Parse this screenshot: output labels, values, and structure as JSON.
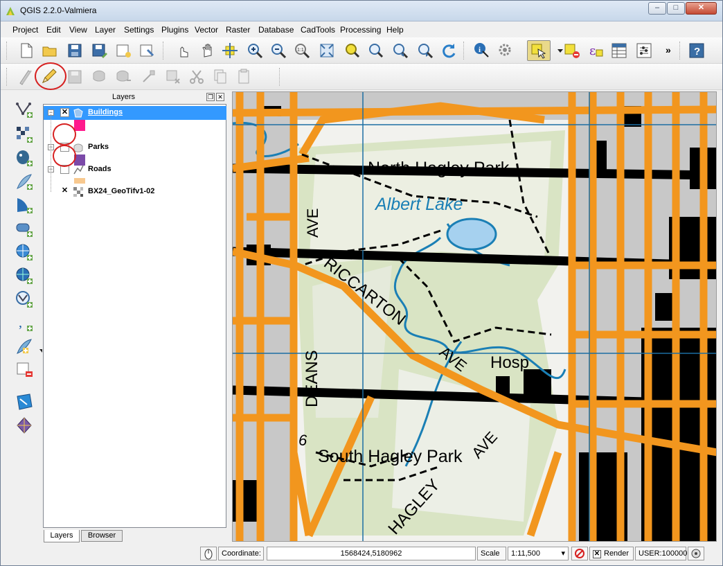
{
  "window": {
    "title": "QGIS 2.2.0-Valmiera",
    "min": "–",
    "max": "□",
    "close": "✕"
  },
  "menubar": [
    "Project",
    "Edit",
    "View",
    "Layer",
    "Settings",
    "Plugins",
    "Vector",
    "Raster",
    "Database",
    "CadTools",
    "Processing",
    "Help"
  ],
  "toolbar_overflow": "»",
  "layers_panel": {
    "title": "Layers",
    "float_label": "❐",
    "close_label": "✕",
    "layers": [
      {
        "name": "Buildings",
        "checked": true,
        "expanded": true,
        "selected": true,
        "swatch": "#ff1a8c"
      },
      {
        "name": "Parks",
        "checked": false,
        "expanded": true,
        "selected": false,
        "swatch": "#7b4aa8"
      },
      {
        "name": "Roads",
        "checked": false,
        "expanded": true,
        "selected": false,
        "swatch": "#f8c98f"
      },
      {
        "name": "BX24_GeoTifv1-02",
        "checked": true,
        "expanded": false,
        "selected": false,
        "swatch": ""
      }
    ],
    "tabs": [
      "Layers",
      "Browser"
    ]
  },
  "map": {
    "labels": {
      "north_hagley": "North Hagley Park",
      "albert_lake": "Albert Lake",
      "ave": "AVE",
      "riccarton": "RICCARTON",
      "ave2": "AVE",
      "hosp": "Hosp",
      "deans": "DEANS",
      "six": "6",
      "south_hagley": "South Hagley Park",
      "hagley": "HAGLEY",
      "ave3": "AVE"
    },
    "colors": {
      "road": "#f2961e",
      "park": "#d9e4c4",
      "water": "#1a7fb5",
      "building": "#000000",
      "block": "#c8c8c8",
      "grid": "#1c6ea3"
    }
  },
  "statusbar": {
    "coordinate_label": "Coordinate:",
    "coordinate_value": "1568424,5180962",
    "scale_label": "Scale",
    "scale_value": "1:11,500",
    "render_label": "Render",
    "crs": "USER:100000",
    "render_checked": true
  }
}
